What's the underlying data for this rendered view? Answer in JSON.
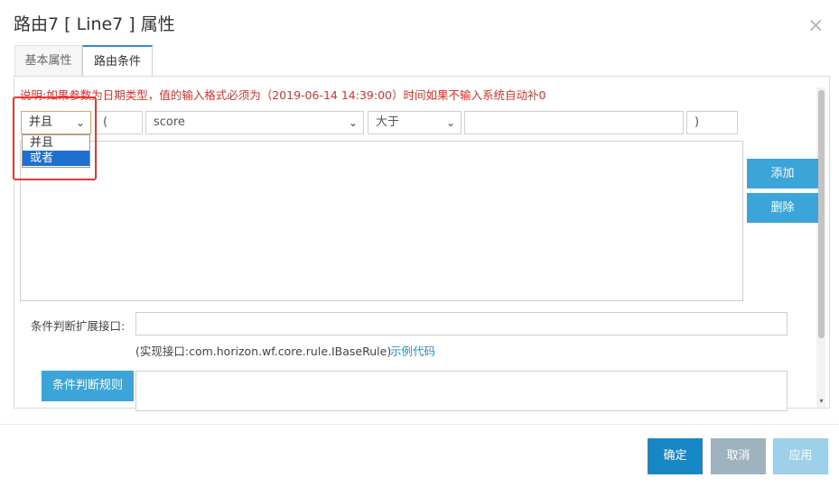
{
  "dialog": {
    "title": "路由7 [ Line7 ] 属性",
    "close_icon": "×"
  },
  "tabs": [
    {
      "label": "基本属性",
      "active": false
    },
    {
      "label": "路由条件",
      "active": true
    }
  ],
  "note": "说明:如果参数为日期类型，值的输入格式必须为（2019-06-14 14:39:00）时间如果不输入系统自动补0",
  "condition_row": {
    "logic_value": "并且",
    "left_paren": "(",
    "field_value": "score",
    "operator_value": "大于",
    "value": "",
    "right_paren": ")",
    "caret": "⌄"
  },
  "logic_dropdown": {
    "options": [
      "并且",
      "或者"
    ],
    "highlighted_index": 1
  },
  "side_buttons": {
    "add": "添加",
    "delete": "删除"
  },
  "extension": {
    "label": "条件判断扩展接口:",
    "value": "",
    "hint": "(实现接口:com.horizon.wf.core.rule.IBaseRule)",
    "link": "示例代码"
  },
  "rule": {
    "button": "条件判断规则",
    "value": ""
  },
  "footer": {
    "ok": "确定",
    "cancel": "取消",
    "apply": "应用"
  },
  "colors": {
    "accent": "#3ba4d8",
    "primary": "#1787c6",
    "note": "#e0302a",
    "highlight": "#e53935"
  }
}
